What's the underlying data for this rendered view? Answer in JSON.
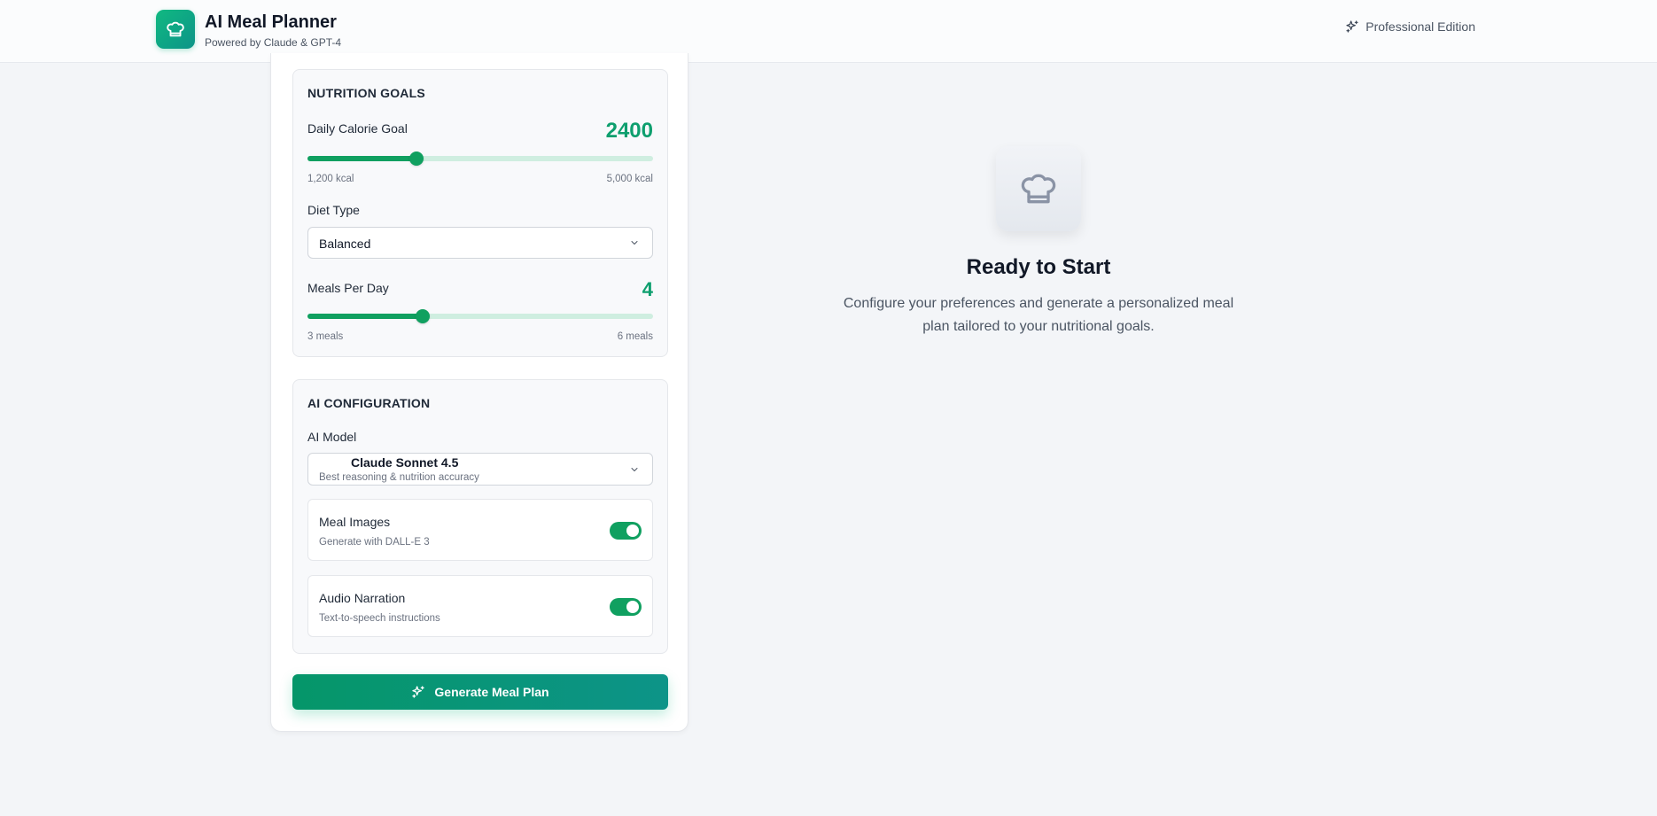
{
  "header": {
    "title": "AI Meal Planner",
    "subtitle": "Powered by Claude & GPT-4",
    "edition": "Professional Edition"
  },
  "nutrition": {
    "section_title": "NUTRITION GOALS",
    "calorie": {
      "label": "Daily Calorie Goal",
      "value": "2400",
      "min_label": "1,200 kcal",
      "max_label": "5,000 kcal",
      "min": 1200,
      "max": 5000,
      "current": 2400
    },
    "diet": {
      "label": "Diet Type",
      "selected": "Balanced"
    },
    "meals": {
      "label": "Meals Per Day",
      "value": "4",
      "min_label": "3 meals",
      "max_label": "6 meals",
      "min": 3,
      "max": 6,
      "current": 4
    }
  },
  "ai_config": {
    "section_title": "AI CONFIGURATION",
    "model": {
      "label": "AI Model",
      "selected_name": "Claude Sonnet 4.5",
      "selected_desc": "Best reasoning & nutrition accuracy"
    },
    "toggles": [
      {
        "title": "Meal Images",
        "subtitle": "Generate with DALL-E 3",
        "on": true
      },
      {
        "title": "Audio Narration",
        "subtitle": "Text-to-speech instructions",
        "on": true
      }
    ]
  },
  "generate_button": {
    "label": "Generate Meal Plan"
  },
  "empty_state": {
    "title": "Ready to Start",
    "description": "Configure your preferences and generate a personalized meal plan tailored to your nutritional goals.",
    "icon": "chef-hat-icon"
  },
  "colors": {
    "accent": "#10a060",
    "accent_dark": "#0d9488",
    "track": "#cfeee0"
  }
}
